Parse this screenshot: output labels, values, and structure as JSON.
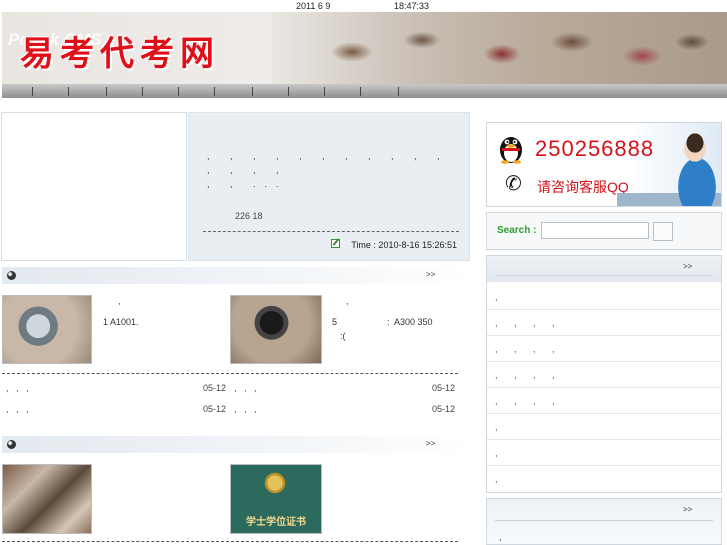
{
  "datebar": {
    "date": "2011 6 9",
    "time": "18:47:33"
  },
  "banner": {
    "logo_text": "易考代考网",
    "ghost_text": "Pcook CMS"
  },
  "article": {
    "excerpt_line1": ", , , , , , , , , , , , , , ,",
    "excerpt_line2": ", , ...",
    "stats": "226    18",
    "time": "Time : 2010-8-16 15:26:51"
  },
  "section1": {
    "more": ">>",
    "items": [
      {
        "marker": ",",
        "text": "1          A1001."
      },
      {
        "marker": ",",
        "text": "5                    :  A300 350",
        "text2": ":("
      }
    ],
    "list": [
      {
        "left": ",   ,   ,",
        "date_left": "05-12",
        "right": ",   ,   ,",
        "date_right": "05-12"
      },
      {
        "left": ",   ,   ,",
        "date_left": "05-12",
        "right": ",   ,   ,",
        "date_right": "05-12"
      }
    ]
  },
  "section2": {
    "more": ">>",
    "cert_text": "学士学位证书"
  },
  "contact": {
    "qq": "250256888",
    "ask": "请咨询客服QQ"
  },
  "search": {
    "label": "Search :",
    "value": ""
  },
  "sidebar_list": {
    "more": ">>",
    "items": [
      ",",
      ",  ,  ,  ,",
      ",  ,  ,  ,",
      ",  ,  ,  ,",
      ",  ,  ,  ,",
      ",",
      ",",
      ","
    ]
  },
  "sidebar_list2": {
    "more": ">>",
    "item": ","
  }
}
